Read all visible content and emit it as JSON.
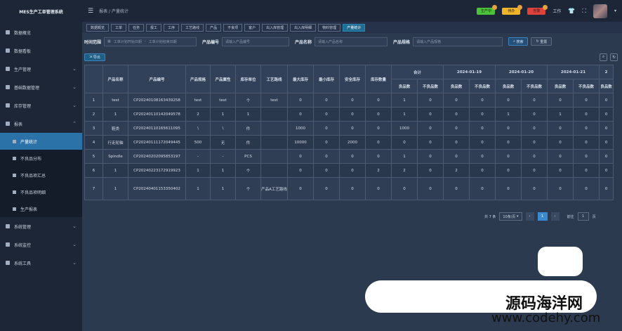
{
  "app": {
    "title": "MES生产工单管理系统"
  },
  "sidebar": {
    "items": [
      {
        "label": "数据概览",
        "icon": "dashboard-icon",
        "expandable": false
      },
      {
        "label": "数据看板",
        "icon": "monitor-icon",
        "expandable": false
      },
      {
        "label": "生产管理",
        "icon": "folder-icon",
        "expandable": true
      },
      {
        "label": "基础数据管理",
        "icon": "folder-icon",
        "expandable": true
      },
      {
        "label": "库存管理",
        "icon": "box-icon",
        "expandable": true
      },
      {
        "label": "报表",
        "icon": "report-icon",
        "expandable": true
      }
    ],
    "sub_items": [
      {
        "label": "产量统计",
        "active": true
      },
      {
        "label": "不良品分布"
      },
      {
        "label": "不良品项汇总"
      },
      {
        "label": "不良品项明细"
      },
      {
        "label": "生产报表"
      }
    ],
    "bottom_items": [
      {
        "label": "系统管理",
        "icon": "gear-icon"
      },
      {
        "label": "系统监控",
        "icon": "monitor-icon"
      },
      {
        "label": "系统工具",
        "icon": "tool-icon"
      }
    ]
  },
  "header": {
    "breadcrumb": [
      "报表",
      "产量统计"
    ],
    "badges": [
      {
        "label": "生产中",
        "color": "#4cc23a"
      },
      {
        "label": "待办",
        "color": "#f0b429"
      },
      {
        "label": "告警",
        "color": "#e0413a"
      }
    ],
    "user_label": "工作"
  },
  "tags": [
    "数据概览",
    "工单",
    "任务",
    "报工",
    "工序",
    "工艺路线",
    "产品",
    "不良项",
    "客户",
    "出入库管理",
    "出入库明细",
    "物料管理",
    "产量统计"
  ],
  "filter": {
    "time_label": "时间范围",
    "start_placeholder": "工单计划开始日期",
    "sep": "-",
    "end_placeholder": "工单计划结束日期",
    "code_label": "产品编号",
    "code_placeholder": "请输入产品编号",
    "name_label": "产品名称",
    "name_placeholder": "请输入产品名称",
    "spec_label": "产品规格",
    "spec_placeholder": "请输入产品规格",
    "search_label": "搜索",
    "reset_label": "重置"
  },
  "toolbar": {
    "export_label": "导出"
  },
  "table": {
    "headers": [
      "",
      "产品名称",
      "产品编号",
      "产品规格",
      "产品属性",
      "库存单位",
      "工艺路线",
      "最大库存",
      "最小库存",
      "安全库存",
      "库存数量"
    ],
    "group_headers": [
      "合计",
      "2024-01-19",
      "2024-01-20",
      "2024-01-21",
      "2"
    ],
    "sub_headers": [
      "良品数",
      "不良品数"
    ],
    "rows": [
      {
        "cells": [
          "1",
          "test",
          "CP20240108163439258",
          "test",
          "test",
          "个",
          "test",
          "0",
          "0",
          "0",
          "0"
        ],
        "groups": [
          "1",
          "0",
          "0",
          "0",
          "0",
          "0",
          "0",
          "0",
          "0"
        ]
      },
      {
        "cells": [
          "2",
          "1",
          "CP20240110142049578",
          "2",
          "1",
          "1",
          "",
          "0",
          "0",
          "0",
          "0"
        ],
        "groups": [
          "1",
          "0",
          "0",
          "0",
          "1",
          "0",
          "1",
          "0",
          "0"
        ]
      },
      {
        "cells": [
          "3",
          "鞋类",
          "CP20240110165611095",
          "\\",
          "\\",
          "件",
          "",
          "1000",
          "0",
          "0",
          "0"
        ],
        "groups": [
          "1000",
          "0",
          "0",
          "0",
          "0",
          "0",
          "0",
          "0",
          "0"
        ]
      },
      {
        "cells": [
          "4",
          "行走轮轴",
          "CP20240111172049445",
          "500",
          "无",
          "件",
          "",
          "10000",
          "0",
          "2000",
          "0"
        ],
        "groups": [
          "0",
          "0",
          "0",
          "0",
          "0",
          "0",
          "0",
          "0",
          "0"
        ]
      },
      {
        "cells": [
          "5",
          "Spindle",
          "CP20240202095853197",
          "-",
          "-",
          "PCS",
          "",
          "0",
          "0",
          "0",
          "0"
        ],
        "groups": [
          "1",
          "0",
          "0",
          "0",
          "0",
          "0",
          "0",
          "0",
          "0"
        ]
      },
      {
        "cells": [
          "6",
          "1",
          "CP20240223172919923",
          "1",
          "1",
          "个",
          "",
          "0",
          "0",
          "0",
          "2"
        ],
        "groups": [
          "2",
          "0",
          "2",
          "0",
          "0",
          "0",
          "0",
          "0",
          "0"
        ]
      },
      {
        "cells": [
          "7",
          "1",
          "CP20240401153350402",
          "1",
          "1",
          "个",
          "产品A工艺路线",
          "0",
          "0",
          "0",
          "0"
        ],
        "groups": [
          "0",
          "0",
          "0",
          "0",
          "0",
          "0",
          "0",
          "0",
          "0"
        ]
      }
    ]
  },
  "pagination": {
    "total": "共 7 条",
    "page_size": "10条/页",
    "current": "1",
    "goto_label": "前往",
    "goto_value": "1",
    "page_suffix": "页"
  },
  "watermark": {
    "line1": "源码海洋网",
    "line2": "www.codehy.com"
  }
}
